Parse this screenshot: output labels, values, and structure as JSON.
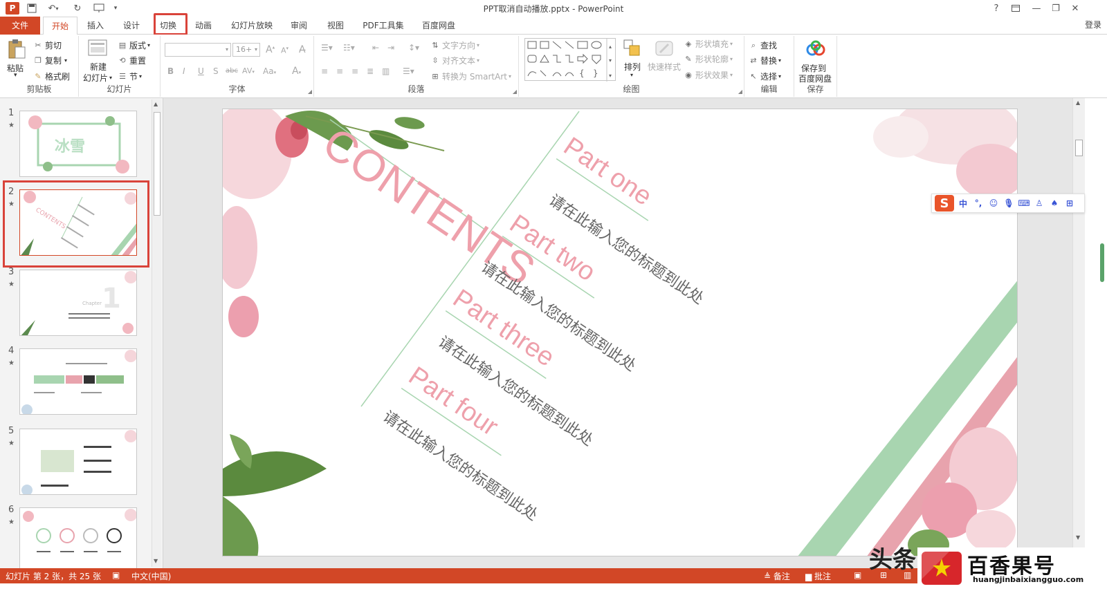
{
  "window": {
    "title": "PPT取消自动播放.pptx - PowerPoint",
    "app_icon": "P",
    "help": "?",
    "signin": "登录"
  },
  "tabs": [
    {
      "label": "文件"
    },
    {
      "label": "开始"
    },
    {
      "label": "插入"
    },
    {
      "label": "设计"
    },
    {
      "label": "切换"
    },
    {
      "label": "动画"
    },
    {
      "label": "幻灯片放映"
    },
    {
      "label": "审阅"
    },
    {
      "label": "视图"
    },
    {
      "label": "PDF工具集"
    },
    {
      "label": "百度网盘"
    }
  ],
  "ribbon": {
    "clipboard": {
      "label": "剪贴板",
      "paste": "粘贴",
      "cut": "剪切",
      "copy": "复制",
      "format_painter": "格式刷"
    },
    "slides": {
      "label": "幻灯片",
      "new_slide_1": "新建",
      "new_slide_2": "幻灯片",
      "layout": "版式",
      "reset": "重置",
      "section": "节"
    },
    "font": {
      "label": "字体",
      "size": "16+",
      "bold": "B",
      "italic": "I",
      "underline": "U",
      "shadow": "S",
      "strike": "abc",
      "spacing": "AV",
      "case": "Aa",
      "color": "A",
      "grow": "A",
      "shrink": "A"
    },
    "paragraph": {
      "label": "段落",
      "text_direction": "文字方向",
      "align_text": "对齐文本",
      "smartart": "转换为 SmartArt"
    },
    "drawing": {
      "label": "绘图",
      "arrange": "排列",
      "quick_styles": "快速样式",
      "fill": "形状填充",
      "outline": "形状轮廓",
      "effects": "形状效果"
    },
    "editing": {
      "label": "编辑",
      "find": "查找",
      "replace": "替换",
      "select": "选择"
    },
    "save": {
      "label": "保存",
      "btn_1": "保存到",
      "btn_2": "百度网盘"
    }
  },
  "thumbnails": [
    {
      "num": "1",
      "star": "★",
      "text": "冰雪"
    },
    {
      "num": "2",
      "star": "★",
      "text": "CONTENTS"
    },
    {
      "num": "3",
      "star": "★",
      "text": "Chapter"
    },
    {
      "num": "4",
      "star": "★",
      "text": ""
    },
    {
      "num": "5",
      "star": "★",
      "text": ""
    },
    {
      "num": "6",
      "star": "★",
      "text": ""
    }
  ],
  "slide": {
    "heading": "CONTENTS",
    "parts": [
      {
        "title": "Part one",
        "sub": "请在此输入您的标题到此处"
      },
      {
        "title": "Part two",
        "sub": "请在此输入您的标题到此处"
      },
      {
        "title": "Part three",
        "sub": "请在此输入您的标题到此处"
      },
      {
        "title": "Part four",
        "sub": "请在此输入您的标题到此处"
      }
    ]
  },
  "ime": {
    "logo": "S",
    "mode": "中",
    "punct": "°,"
  },
  "status": {
    "slide_info": "幻灯片 第 2 张，共 25 张",
    "language": "中文(中国)",
    "notes": "备注",
    "comments": "批注"
  },
  "watermark": {
    "left_text": "头条",
    "title": "百香果号",
    "url": "huangjinbaixiangguo.com"
  },
  "colors": {
    "accent": "#d24726",
    "highlight": "#d9433a",
    "pink": "#e8a3ad",
    "green": "#a8d5b0"
  }
}
